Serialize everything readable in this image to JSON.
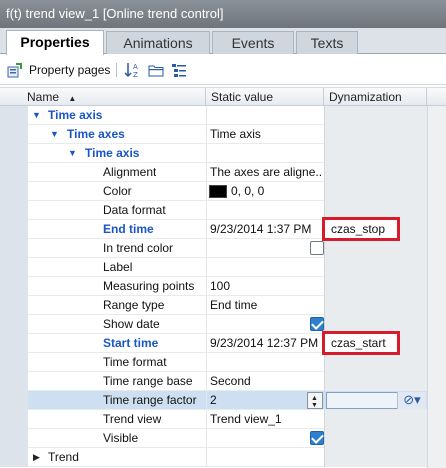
{
  "window": {
    "title": "f(t) trend view_1 [Online trend control]"
  },
  "tabs": [
    {
      "label": "Properties",
      "active": true
    },
    {
      "label": "Animations",
      "active": false
    },
    {
      "label": "Events",
      "active": false
    },
    {
      "label": "Texts",
      "active": false
    }
  ],
  "toolbar": {
    "property_pages_label": "Property pages"
  },
  "columns": {
    "name": "Name",
    "static": "Static value",
    "dynamization": "Dynamization"
  },
  "rows": [
    {
      "name": "Time axis",
      "value": ""
    },
    {
      "name": "Time axes",
      "value": "Time axis"
    },
    {
      "name": "Time axis",
      "value": ""
    },
    {
      "name": "Alignment",
      "value": "The axes are aligne.."
    },
    {
      "name": "Color",
      "value": "0, 0, 0"
    },
    {
      "name": "Data format",
      "value": ""
    },
    {
      "name": "End time",
      "value": "9/23/2014 1:37 PM",
      "dyn": "czas_stop"
    },
    {
      "name": "In trend color",
      "value": "",
      "checked": false
    },
    {
      "name": "Label",
      "value": ""
    },
    {
      "name": "Measuring points",
      "value": "100"
    },
    {
      "name": "Range type",
      "value": "End time"
    },
    {
      "name": "Show date",
      "value": "",
      "checked": true
    },
    {
      "name": "Start time",
      "value": "9/23/2014 12:37 PM",
      "dyn": "czas_start"
    },
    {
      "name": "Time format",
      "value": ""
    },
    {
      "name": "Time range base",
      "value": "Second"
    },
    {
      "name": "Time range factor",
      "value": "2"
    },
    {
      "name": "Trend view",
      "value": "Trend view_1"
    },
    {
      "name": "Visible",
      "value": "",
      "checked": true
    },
    {
      "name": "Trend",
      "value": ""
    }
  ],
  "colors": {
    "accent_text": "#1a56c4",
    "highlight_border": "#d81b2b",
    "swatch": "#000000"
  },
  "icons": {
    "property_pages": "property-pages-icon",
    "sort": "sort-az-icon",
    "folder": "folder-icon",
    "list": "list-view-icon",
    "no_dyn": "no-dynamization-icon"
  }
}
